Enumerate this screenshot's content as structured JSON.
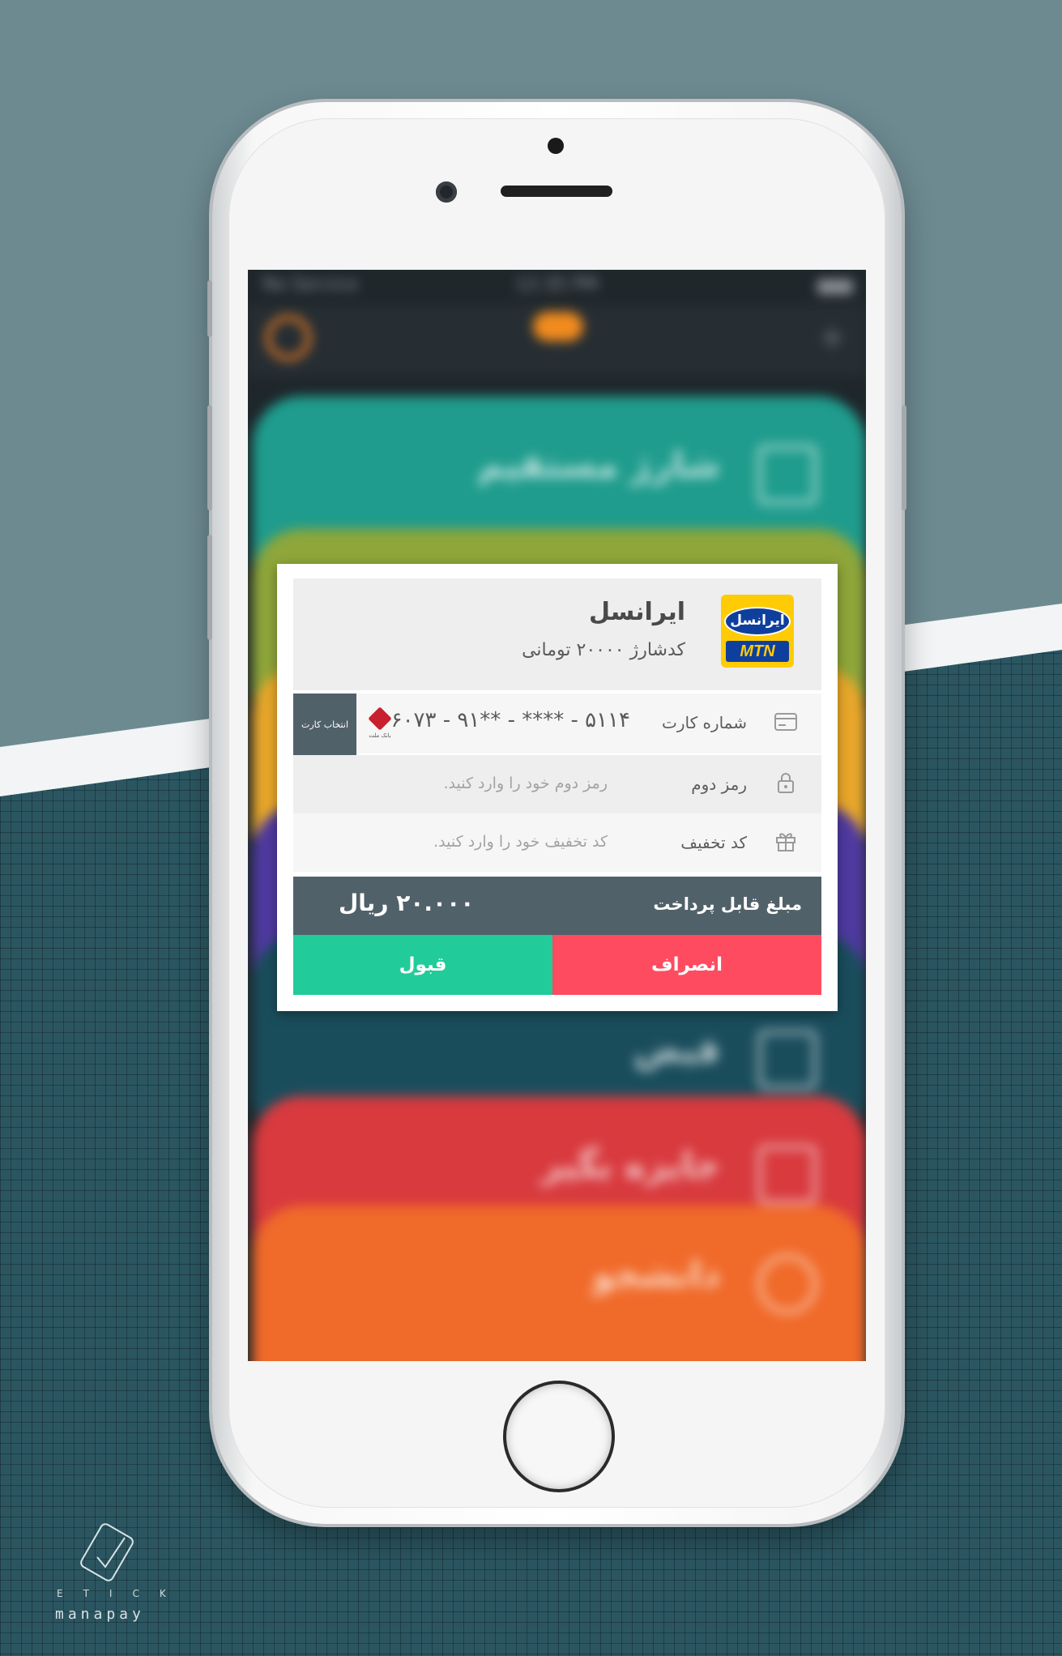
{
  "status_bar": {
    "carrier": "No Service",
    "time": "12:35 PM"
  },
  "background_cards": [
    {
      "label": "شارژ مستقیم",
      "color": "#1f9c8d"
    },
    {
      "label": "",
      "color": "#8ea63a"
    },
    {
      "label": "",
      "color": "#e8a72a"
    },
    {
      "label": "",
      "color": "#4f3aa0"
    },
    {
      "label": "قبض",
      "color": "#1a4d5c"
    },
    {
      "label": "جایزه بگیر",
      "color": "#d83a3e"
    },
    {
      "label": "دانشجو",
      "color": "#f06a2a"
    }
  ],
  "modal": {
    "operator": {
      "logo_text_top": "ایرانسل",
      "logo_text_bottom": "MTN",
      "name": "ایرانسل",
      "subtitle": "کدشارژ ۲۰۰۰۰ تومانی"
    },
    "card_row": {
      "label": "شماره کارت",
      "number": "۶۰۷۳ - ۹۱** - **** - ۵۱۱۴",
      "choose_card": "انتخاب کارت",
      "bank_name": "بانک ملت",
      "icon": "credit-card-icon"
    },
    "password_row": {
      "label": "رمز دوم",
      "placeholder": "رمز دوم خود را وارد کنید.",
      "icon": "lock-icon"
    },
    "discount_row": {
      "label": "کد تخفیف",
      "placeholder": "کد تخفیف خود را وارد کنید.",
      "icon": "gift-icon"
    },
    "payment": {
      "label": "مبلغ قابل پرداخت",
      "amount": "۲۰.۰۰۰ ریال"
    },
    "buttons": {
      "accept": "قبول",
      "cancel": "انصراف"
    }
  },
  "brand": {
    "small": "ETICK",
    "name": "manapay"
  },
  "colors": {
    "accept": "#22cb9a",
    "cancel": "#ff4b60",
    "bar": "#516169",
    "background": "#6d8a91"
  }
}
